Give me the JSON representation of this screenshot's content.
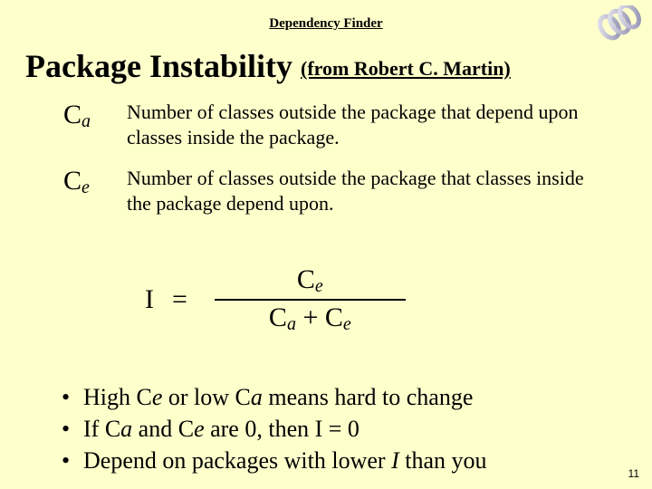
{
  "header": {
    "title": "Dependency Finder",
    "logo_name": "chain-link-logo"
  },
  "title": {
    "main": "Package Instability",
    "attribution": "(from Robert C. Martin)"
  },
  "definitions": [
    {
      "symbol_base": "C",
      "symbol_sub": "a",
      "text": "Number of classes outside the package that depend upon classes inside the package."
    },
    {
      "symbol_base": "C",
      "symbol_sub": "e",
      "text": "Number of classes outside the package that classes inside the package depend upon."
    }
  ],
  "formula": {
    "lhs": "I",
    "eq": "=",
    "numerator_base": "C",
    "numerator_sub": "e",
    "denom_left_base": "C",
    "denom_left_sub": "a",
    "plus": " + ",
    "denom_right_base": "C",
    "denom_right_sub": "e"
  },
  "bullets": [
    {
      "pre": "High C",
      "sub1": "e",
      "mid": " or low C",
      "sub2": "a",
      "post": " means hard to change"
    },
    {
      "pre": "If C",
      "sub1": "a",
      "mid": " and C",
      "sub2": "e",
      "post": " are 0, then I = 0"
    },
    {
      "pre": "Depend on packages with lower ",
      "italic": "I",
      "post2": " than you"
    }
  ],
  "page_number": "11"
}
